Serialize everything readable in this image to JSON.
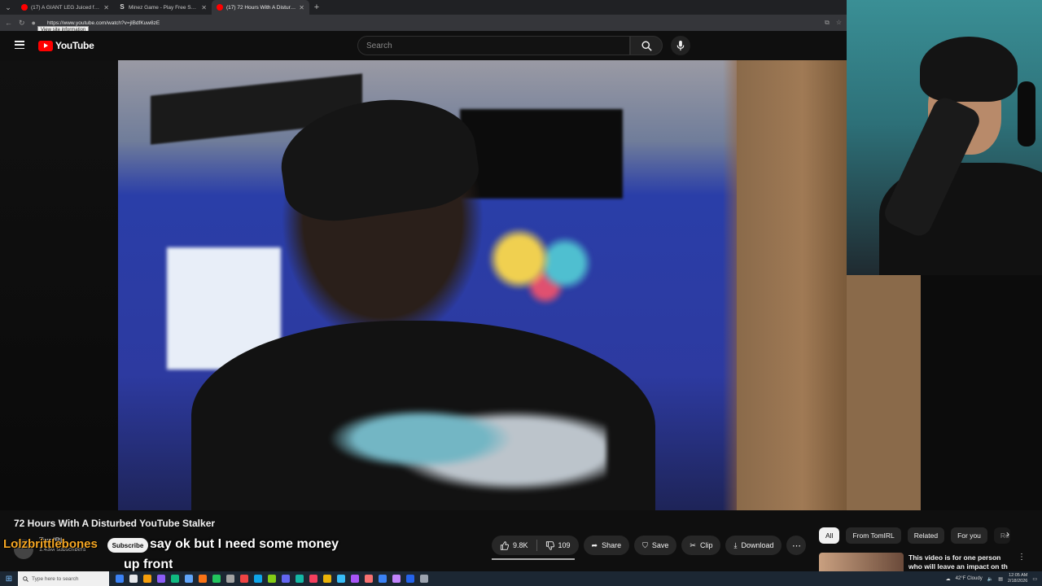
{
  "browser": {
    "tabs": [
      {
        "label": "(17) A GIANT LEG Juiced from the",
        "favicon": "yt",
        "active": false
      },
      {
        "label": "Minez Game - Play Free Social Ca",
        "favicon": "s",
        "active": false
      },
      {
        "label": "(17) 72 Hours With A Disturbed Yo",
        "favicon": "yt",
        "active": true
      }
    ],
    "url": "https://www.youtube.com/watch?v=jlBdfKuw8zE",
    "tooltip": "View site information"
  },
  "youtube": {
    "logo": "YouTube",
    "search_placeholder": "Search"
  },
  "video": {
    "title": "72 Hours With A Disturbed YouTube Stalker",
    "channel": "TomIRL",
    "subscribers": "1.43M subscribers",
    "subscribe_label": "Subscribe",
    "likes": "9.8K",
    "dislikes": "109",
    "share": "Share",
    "save": "Save",
    "clip": "Clip",
    "download": "Download"
  },
  "chips": [
    "All",
    "From TomIRL",
    "Related",
    "For you",
    "Re"
  ],
  "recommended": {
    "title": "This video is for one person who will leave an impact on th"
  },
  "overlay": {
    "username": "Lolzbrittlebones",
    "caption_line1": "say ok but I need some money",
    "caption_line2": "up front"
  },
  "taskbar": {
    "search_placeholder": "Type here to search",
    "weather": "42°F  Cloudy",
    "time": "12:05 AM",
    "date": "2/18/2026",
    "icon_colors": [
      "#3b82f6",
      "#e5e7eb",
      "#f59e0b",
      "#8b5cf6",
      "#10b981",
      "#60a5fa",
      "#f97316",
      "#22c55e",
      "#a3a3a3",
      "#ef4444",
      "#0ea5e9",
      "#84cc16",
      "#6366f1",
      "#14b8a6",
      "#f43f5e",
      "#eab308",
      "#38bdf8",
      "#a855f7",
      "#f87171",
      "#3b82f6",
      "#c084fc",
      "#2563eb",
      "#9ca3af"
    ]
  }
}
